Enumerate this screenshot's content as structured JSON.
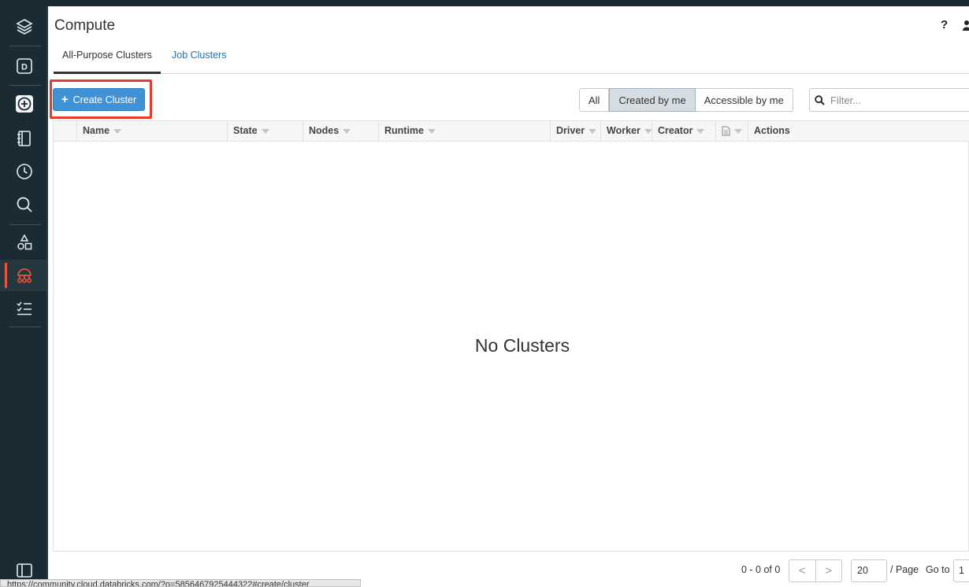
{
  "sidebar": {
    "items": [
      {
        "id": "workspace",
        "icon": "layers-icon"
      },
      {
        "id": "home",
        "icon": "d-badge-icon",
        "text": "D"
      },
      {
        "id": "create",
        "icon": "plus-circle-icon"
      },
      {
        "id": "notebooks",
        "icon": "notebook-icon"
      },
      {
        "id": "recents",
        "icon": "clock-icon"
      },
      {
        "id": "search",
        "icon": "search-icon"
      },
      {
        "id": "data",
        "icon": "shapes-icon"
      },
      {
        "id": "compute",
        "icon": "cluster-icon",
        "active": true
      },
      {
        "id": "jobs",
        "icon": "checklist-icon"
      }
    ],
    "bottom_icon": "panel-toggle-icon",
    "accent_color": "#e8563d"
  },
  "header": {
    "title": "Compute",
    "help_label": "?"
  },
  "tabs": [
    {
      "label": "All-Purpose Clusters",
      "active": true
    },
    {
      "label": "Job Clusters",
      "active": false
    }
  ],
  "toolbar": {
    "create_label": "Create Cluster",
    "filters": [
      {
        "label": "All",
        "selected": false
      },
      {
        "label": "Created by me",
        "selected": true
      },
      {
        "label": "Accessible by me",
        "selected": false
      }
    ],
    "filter_placeholder": "Filter..."
  },
  "table": {
    "columns": [
      "Name",
      "State",
      "Nodes",
      "Runtime",
      "Driver",
      "Worker",
      "Creator",
      "",
      "Actions"
    ],
    "empty_message": "No Clusters"
  },
  "pagination": {
    "count_text": "0 - 0 of 0",
    "prev": "<",
    "next": ">",
    "page_size": "20",
    "per_page_label": "/ Page",
    "goto_label": "Go to",
    "goto_value": "1"
  },
  "status_bar": {
    "url": "https://community.cloud.databricks.com/?o=5856467925444322#create/cluster"
  },
  "colors": {
    "sidebar_bg": "#1b2b34",
    "primary_button": "#3f92d6",
    "highlight_box": "#e53b2c",
    "link": "#1a73b8"
  }
}
